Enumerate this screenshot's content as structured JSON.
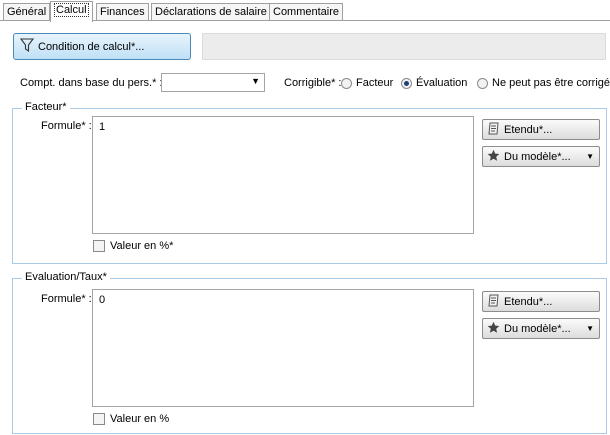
{
  "tabs": [
    {
      "label": "Général"
    },
    {
      "label": "Calcul"
    },
    {
      "label": "Finances"
    },
    {
      "label": "Déclarations de salaire"
    },
    {
      "label": "Commentaire"
    }
  ],
  "condition_button": {
    "label": "Condition de calcul*...",
    "icon": "funnel-icon"
  },
  "compt": {
    "label": "Compt. dans base du pers.* :",
    "value": ""
  },
  "corrigible": {
    "label": "Corrigible* :",
    "options": [
      {
        "label": "Facteur",
        "checked": false
      },
      {
        "label": "Évaluation",
        "checked": true
      },
      {
        "label": "Ne peut pas être corrigé",
        "checked": false
      }
    ]
  },
  "facteur": {
    "title": "Facteur*",
    "formula_label": "Formule* :",
    "formula_value": "1",
    "etendu_label": "Etendu*...",
    "modele_label": "Du modèle*...",
    "checkbox_label": "Valeur en %*",
    "checked": false
  },
  "evaluation": {
    "title": "Evaluation/Taux*",
    "formula_label": "Formule* :",
    "formula_value": "0",
    "etendu_label": "Etendu*...",
    "modele_label": "Du modèle*...",
    "checkbox_label": "Valeur en %",
    "checked": false
  }
}
